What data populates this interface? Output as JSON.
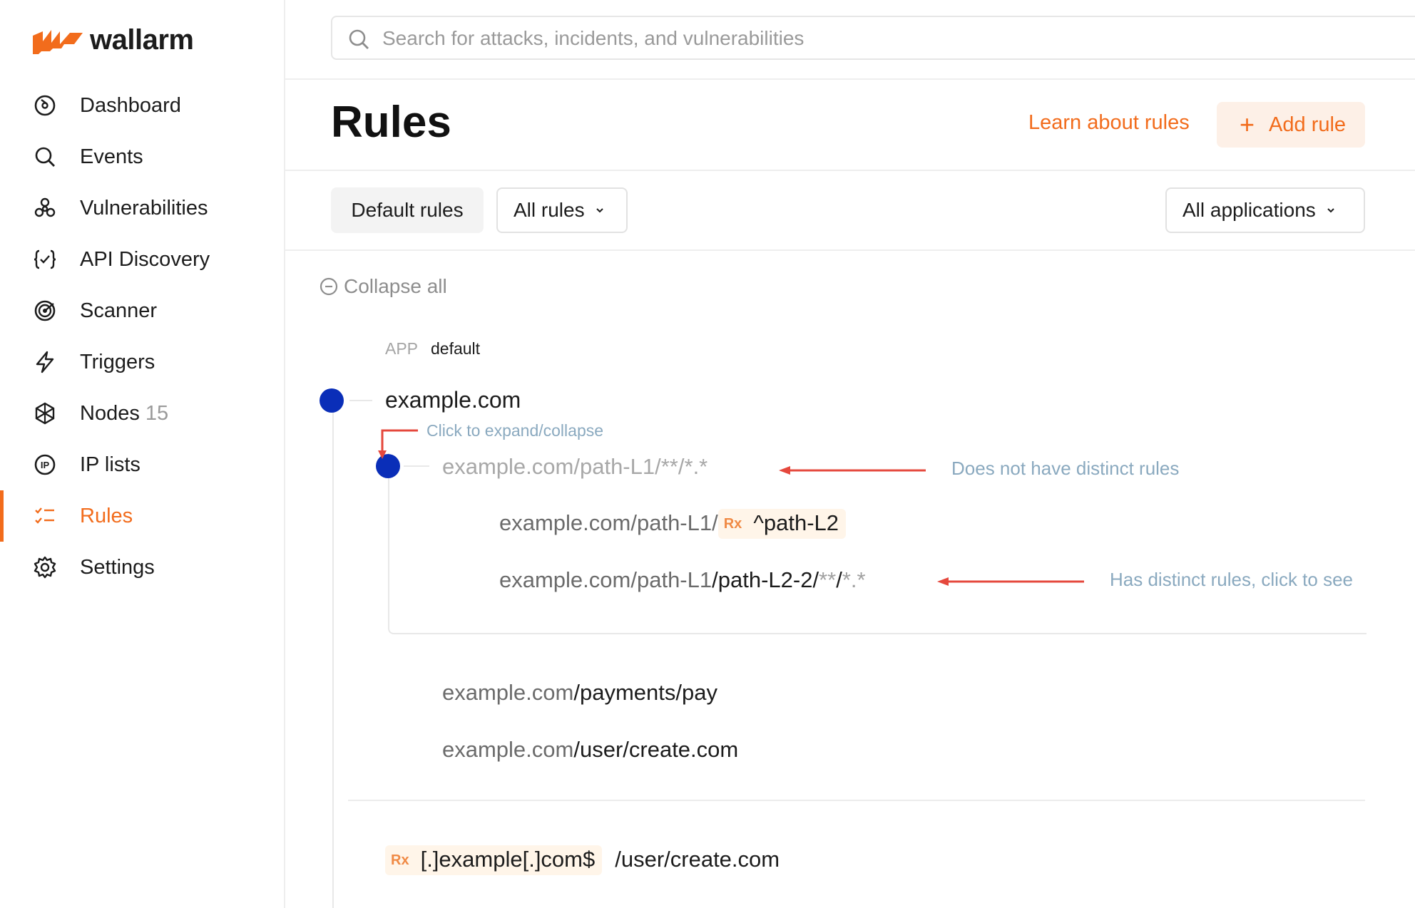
{
  "brand": {
    "name": "wallarm",
    "accent": "#f26c1c",
    "dot_color": "#0a2eb8",
    "annotation_color": "#8aa9bf"
  },
  "nav": [
    {
      "label": "Dashboard",
      "icon": "dashboard-icon"
    },
    {
      "label": "Events",
      "icon": "search-icon"
    },
    {
      "label": "Vulnerabilities",
      "icon": "biohazard-icon"
    },
    {
      "label": "API Discovery",
      "icon": "api-braces-icon"
    },
    {
      "label": "Scanner",
      "icon": "radar-icon"
    },
    {
      "label": "Triggers",
      "icon": "lightning-icon"
    },
    {
      "label": "Nodes",
      "count": "15",
      "icon": "nodes-icon"
    },
    {
      "label": "IP lists",
      "icon": "ip-icon"
    },
    {
      "label": "Rules",
      "icon": "rules-icon",
      "active": true
    },
    {
      "label": "Settings",
      "icon": "gear-icon"
    }
  ],
  "search": {
    "placeholder": "Search for attacks, incidents, and vulnerabilities"
  },
  "header": {
    "title": "Rules",
    "learn_link": "Learn about rules",
    "add_button": "Add rule"
  },
  "filters": {
    "default_rules": "Default rules",
    "rules_dropdown": "All rules",
    "apps_dropdown": "All applications"
  },
  "tree": {
    "collapse_all": "Collapse all",
    "app_label": "APP",
    "app_value": "default",
    "domain": "example.com",
    "branch": {
      "domain": "example.com",
      "path": "/path-L1/",
      "wild1": "**",
      "slash": "/",
      "wild2": "*.*"
    },
    "child1": {
      "domain": "example.com",
      "path": "/path-L1/",
      "rx_tag": "Rx",
      "rx": "^path-L2"
    },
    "child2": {
      "domain": "example.com",
      "path_dim": "/path-L1",
      "path": "/path-L2-2/",
      "wild1": "**",
      "slash": "/",
      "wild2": "*.*"
    },
    "leaf1": {
      "domain": "example.com",
      "path": "/payments/pay"
    },
    "leaf2": {
      "domain": "example.com",
      "path": "/user/create.com"
    },
    "regex_entry": {
      "rx_tag": "Rx",
      "rx": "[.]example[.]com$",
      "path": "/user/create.com"
    }
  },
  "annotations": {
    "expand": "Click to expand/collapse",
    "no_rules": "Does not have distinct rules",
    "has_rules": "Has distinct rules, click to see"
  }
}
